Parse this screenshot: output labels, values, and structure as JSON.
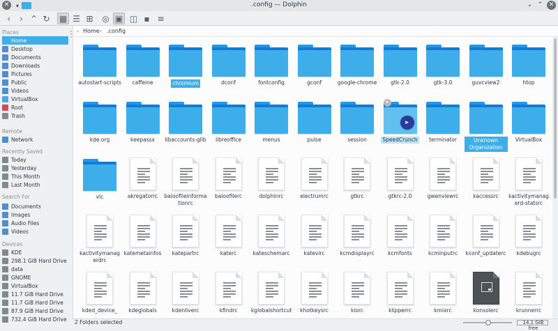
{
  "window": {
    "title": ".config — Dolphin"
  },
  "sidebar": {
    "places_header": "Places",
    "places": [
      {
        "label": "Home",
        "icon": "home-icon",
        "color": "#3daee9"
      },
      {
        "label": "Desktop",
        "icon": "desktop-icon",
        "color": "#4d8fd1"
      },
      {
        "label": "Documents",
        "icon": "documents-icon",
        "color": "#4d8fd1"
      },
      {
        "label": "Downloads",
        "icon": "downloads-icon",
        "color": "#4d8fd1"
      },
      {
        "label": "Pictures",
        "icon": "pictures-icon",
        "color": "#4d8fd1"
      },
      {
        "label": "Public",
        "icon": "public-icon",
        "color": "#4d8fd1"
      },
      {
        "label": "Videos",
        "icon": "videos-icon",
        "color": "#4d8fd1"
      },
      {
        "label": "VirtualBox",
        "icon": "folder-icon",
        "color": "#3daee9"
      },
      {
        "label": "Root",
        "icon": "root-folder-icon",
        "color": "#da4453"
      },
      {
        "label": "Trash",
        "icon": "trash-icon",
        "color": "#7f8c8d"
      }
    ],
    "remote_header": "Remote",
    "remote": [
      {
        "label": "Network",
        "icon": "network-icon",
        "color": "#4d8fd1"
      }
    ],
    "recent_header": "Recently Saved",
    "recent": [
      {
        "label": "Today",
        "icon": "calendar-icon",
        "color": "#7f8c8d"
      },
      {
        "label": "Yesterday",
        "icon": "calendar-icon",
        "color": "#7f8c8d"
      },
      {
        "label": "This Month",
        "icon": "calendar-icon",
        "color": "#7f8c8d"
      },
      {
        "label": "Last Month",
        "icon": "calendar-icon",
        "color": "#7f8c8d"
      }
    ],
    "search_header": "Search For",
    "search": [
      {
        "label": "Documents",
        "icon": "documents-icon",
        "color": "#4d8fd1"
      },
      {
        "label": "Images",
        "icon": "images-icon",
        "color": "#4d8fd1"
      },
      {
        "label": "Audio Files",
        "icon": "audio-icon",
        "color": "#4d8fd1"
      },
      {
        "label": "Videos",
        "icon": "videos-icon",
        "color": "#4d8fd1"
      }
    ],
    "devices_header": "Devices",
    "devices": [
      {
        "label": "KDE",
        "icon": "drive-icon",
        "color": "#7f8c8d"
      },
      {
        "label": "298.1 GiB Hard Drive",
        "icon": "drive-icon",
        "color": "#7f8c8d"
      },
      {
        "label": "data",
        "icon": "drive-icon",
        "color": "#7f8c8d"
      },
      {
        "label": "GNOME",
        "icon": "drive-icon",
        "color": "#7f8c8d"
      },
      {
        "label": "VirtualBox",
        "icon": "drive-icon",
        "color": "#7f8c8d"
      },
      {
        "label": "11.7 GiB Hard Drive",
        "icon": "drive-icon",
        "color": "#7f8c8d"
      },
      {
        "label": "11.7 GiB Hard Drive",
        "icon": "drive-icon",
        "color": "#7f8c8d"
      },
      {
        "label": "87.9 GiB Hard Drive",
        "icon": "drive-icon",
        "color": "#7f8c8d"
      },
      {
        "label": "732.4 GiB Hard Drive",
        "icon": "drive-icon",
        "color": "#7f8c8d"
      }
    ]
  },
  "breadcrumb": {
    "home": "Home",
    "current": ".config"
  },
  "items": [
    {
      "name": "autostart-scripts",
      "kind": "folder"
    },
    {
      "name": "caffeine",
      "kind": "folder"
    },
    {
      "name": "chromium",
      "kind": "folder",
      "state": "selected"
    },
    {
      "name": "dconf",
      "kind": "folder"
    },
    {
      "name": "fontconfig",
      "kind": "folder"
    },
    {
      "name": "gconf",
      "kind": "folder"
    },
    {
      "name": "google-chrome",
      "kind": "folder"
    },
    {
      "name": "gtk-2.0",
      "kind": "folder"
    },
    {
      "name": "gtk-3.0",
      "kind": "folder"
    },
    {
      "name": "guvcview2",
      "kind": "folder"
    },
    {
      "name": "htop",
      "kind": "folder"
    },
    {
      "name": "kde.org",
      "kind": "folder"
    },
    {
      "name": "keepassx",
      "kind": "folder"
    },
    {
      "name": "libaccounts-glib",
      "kind": "folder"
    },
    {
      "name": "libreoffice",
      "kind": "folder"
    },
    {
      "name": "menus",
      "kind": "folder"
    },
    {
      "name": "pulse",
      "kind": "folder"
    },
    {
      "name": "session",
      "kind": "folder"
    },
    {
      "name": "SpeedCrunch",
      "kind": "folder",
      "state": "drop-target"
    },
    {
      "name": "terminator",
      "kind": "folder"
    },
    {
      "name": "Unknown Organization",
      "kind": "folder",
      "state": "selected"
    },
    {
      "name": "VirtualBox",
      "kind": "folder"
    },
    {
      "name": "vlc",
      "kind": "folder"
    },
    {
      "name": "akregatorrc",
      "kind": "file"
    },
    {
      "name": "baloofileinformationrc",
      "kind": "file"
    },
    {
      "name": "baloofilerc",
      "kind": "file"
    },
    {
      "name": "dolphinrc",
      "kind": "file"
    },
    {
      "name": "electrumrc",
      "kind": "file"
    },
    {
      "name": "gtkrc",
      "kind": "file"
    },
    {
      "name": "gtkrc-2.0",
      "kind": "file"
    },
    {
      "name": "gwenviewrc",
      "kind": "file"
    },
    {
      "name": "kaccessrc",
      "kind": "file"
    },
    {
      "name": "kactivitymanagerd-statsrc",
      "kind": "file"
    },
    {
      "name": "kactivitymanagerdrc",
      "kind": "file"
    },
    {
      "name": "katemetainfos",
      "kind": "file"
    },
    {
      "name": "katepartrc",
      "kind": "file"
    },
    {
      "name": "katerc",
      "kind": "file"
    },
    {
      "name": "kateschemarc",
      "kind": "file"
    },
    {
      "name": "katevirc",
      "kind": "file"
    },
    {
      "name": "kcmdisplayrc",
      "kind": "file"
    },
    {
      "name": "kcmfonts",
      "kind": "file"
    },
    {
      "name": "kcminputrc",
      "kind": "file"
    },
    {
      "name": "kconf_updaterc",
      "kind": "file"
    },
    {
      "name": "kdebugrc",
      "kind": "file"
    },
    {
      "name": "kded_device_",
      "kind": "file"
    },
    {
      "name": "kdeglobals",
      "kind": "file"
    },
    {
      "name": "kdenliverc",
      "kind": "file"
    },
    {
      "name": "kfindrc",
      "kind": "file"
    },
    {
      "name": "kglobalshortcut",
      "kind": "file"
    },
    {
      "name": "khotkeysrc",
      "kind": "file"
    },
    {
      "name": "kiorc",
      "kind": "file"
    },
    {
      "name": "klipperrc",
      "kind": "file"
    },
    {
      "name": "kmixrc",
      "kind": "file"
    },
    {
      "name": "konsolerc",
      "kind": "file",
      "variant": "dark"
    },
    {
      "name": "krunnerrc",
      "kind": "file"
    }
  ],
  "status": {
    "selection": "2 Folders selected",
    "free_space": "14.1 GiB free"
  }
}
